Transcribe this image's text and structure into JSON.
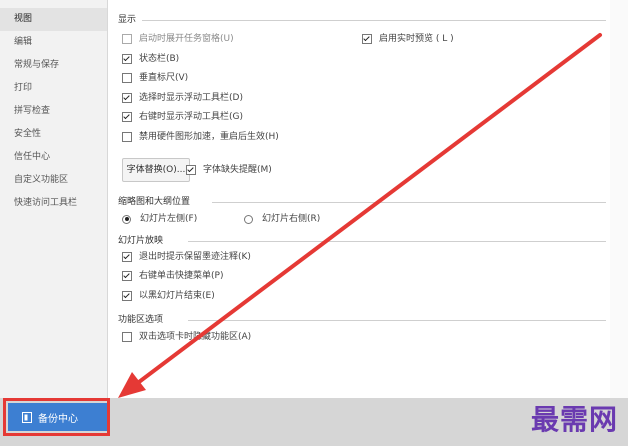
{
  "sidebar": {
    "items": [
      {
        "label": "视图",
        "active": true
      },
      {
        "label": "编辑",
        "active": false
      },
      {
        "label": "常规与保存",
        "active": false
      },
      {
        "label": "打印",
        "active": false
      },
      {
        "label": "拼写检查",
        "active": false
      },
      {
        "label": "安全性",
        "active": false
      },
      {
        "label": "信任中心",
        "active": false
      },
      {
        "label": "自定义功能区",
        "active": false
      },
      {
        "label": "快速访问工具栏",
        "active": false
      }
    ]
  },
  "sections": {
    "display": {
      "title": "显示",
      "options": [
        {
          "label": "启动时展开任务窗格(U)",
          "checked": false,
          "disabled": true
        },
        {
          "label": "启用实时预览 ( L )",
          "checked": true,
          "disabled": false
        },
        {
          "label": "状态栏(B)",
          "checked": true,
          "disabled": false
        },
        {
          "label": "垂直标尺(V)",
          "checked": false,
          "disabled": false
        },
        {
          "label": "选择时显示浮动工具栏(D)",
          "checked": true,
          "disabled": false
        },
        {
          "label": "右键时显示浮动工具栏(G)",
          "checked": true,
          "disabled": false
        },
        {
          "label": "禁用硬件图形加速，重启后生效(H)",
          "checked": false,
          "disabled": false
        }
      ],
      "font_replace_button": "字体替换(O)...",
      "font_missing_label": "字体缺失提醒(M)",
      "font_missing_checked": true
    },
    "thumbnail": {
      "title": "缩略图和大纲位置",
      "left_label": "幻灯片左侧(F)",
      "right_label": "幻灯片右侧(R)",
      "selected": "left"
    },
    "slideshow": {
      "title": "幻灯片放映",
      "options": [
        {
          "label": "退出时提示保留墨迹注释(K)",
          "checked": true
        },
        {
          "label": "右键单击快捷菜单(P)",
          "checked": true
        },
        {
          "label": "以黑幻灯片结束(E)",
          "checked": true
        }
      ]
    },
    "ribbon": {
      "title": "功能区选项",
      "option_label": "双击选项卡时隐藏功能区(A)",
      "checked": false
    }
  },
  "footer": {
    "backup_label": "备份中心",
    "watermark": "最需网"
  },
  "colors": {
    "accent": "#3d7fd2",
    "highlight": "#e53935",
    "watermark": "#6a3ab0"
  },
  "icons": {
    "backup": "backup-icon",
    "arrow": "red-arrow-annotation"
  }
}
